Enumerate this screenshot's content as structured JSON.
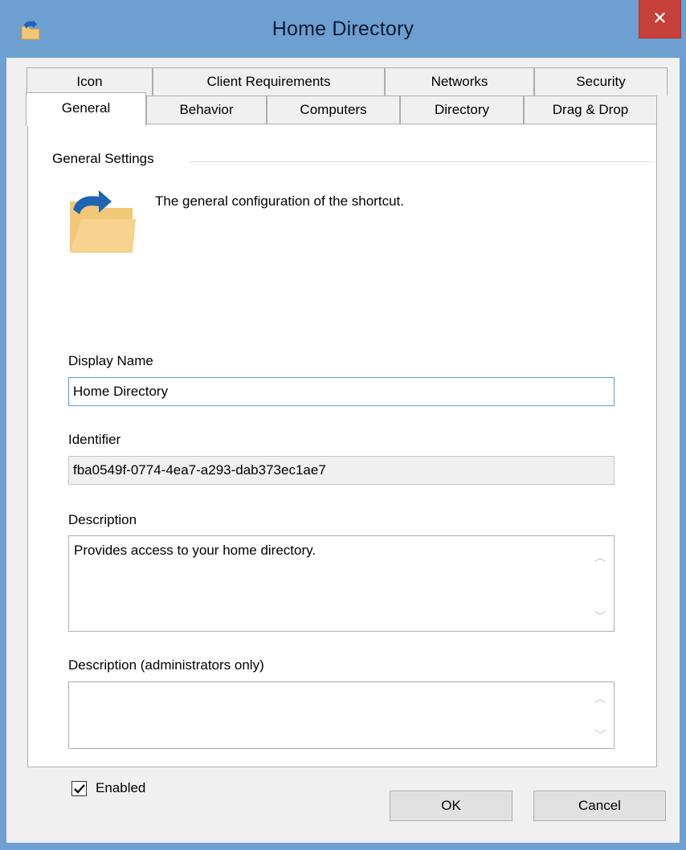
{
  "window": {
    "title": "Home Directory",
    "close_label": "✕"
  },
  "tabs": {
    "row1": [
      "Icon",
      "Client Requirements",
      "Networks",
      "Security"
    ],
    "row2": [
      "General",
      "Behavior",
      "Computers",
      "Directory",
      "Drag & Drop"
    ],
    "active": "General"
  },
  "general": {
    "group_label": "General Settings",
    "description": "The general configuration of the shortcut.",
    "display_name_label": "Display Name",
    "display_name_value": "Home Directory",
    "identifier_label": "Identifier",
    "identifier_value": "fba0549f-0774-4ea7-a293-dab373ec1ae7",
    "description_label": "Description",
    "description_value": "Provides access to your home directory.",
    "admin_description_label": "Description (administrators only)",
    "admin_description_value": "",
    "enabled_label": "Enabled",
    "enabled_checked": true
  },
  "buttons": {
    "ok": "OK",
    "cancel": "Cancel"
  },
  "icons": {
    "app": "folder-shortcut-icon",
    "general": "folder-shortcut-icon"
  },
  "colors": {
    "frame": "#6d9fd1",
    "close": "#c7403a",
    "focus": "#569de5",
    "arrow": "#1e63b4",
    "folder": "#f2c778"
  }
}
